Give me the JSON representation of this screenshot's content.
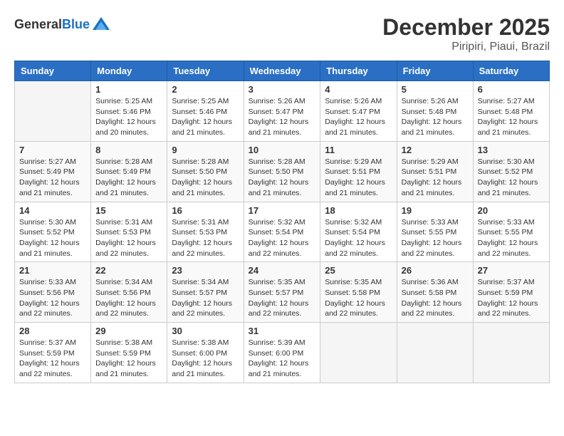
{
  "header": {
    "logo_general": "General",
    "logo_blue": "Blue",
    "month": "December 2025",
    "location": "Piripiri, Piaui, Brazil"
  },
  "weekdays": [
    "Sunday",
    "Monday",
    "Tuesday",
    "Wednesday",
    "Thursday",
    "Friday",
    "Saturday"
  ],
  "weeks": [
    [
      {
        "day": "",
        "info": ""
      },
      {
        "day": "1",
        "info": "Sunrise: 5:25 AM\nSunset: 5:46 PM\nDaylight: 12 hours\nand 20 minutes."
      },
      {
        "day": "2",
        "info": "Sunrise: 5:25 AM\nSunset: 5:46 PM\nDaylight: 12 hours\nand 21 minutes."
      },
      {
        "day": "3",
        "info": "Sunrise: 5:26 AM\nSunset: 5:47 PM\nDaylight: 12 hours\nand 21 minutes."
      },
      {
        "day": "4",
        "info": "Sunrise: 5:26 AM\nSunset: 5:47 PM\nDaylight: 12 hours\nand 21 minutes."
      },
      {
        "day": "5",
        "info": "Sunrise: 5:26 AM\nSunset: 5:48 PM\nDaylight: 12 hours\nand 21 minutes."
      },
      {
        "day": "6",
        "info": "Sunrise: 5:27 AM\nSunset: 5:48 PM\nDaylight: 12 hours\nand 21 minutes."
      }
    ],
    [
      {
        "day": "7",
        "info": "Sunrise: 5:27 AM\nSunset: 5:49 PM\nDaylight: 12 hours\nand 21 minutes."
      },
      {
        "day": "8",
        "info": "Sunrise: 5:28 AM\nSunset: 5:49 PM\nDaylight: 12 hours\nand 21 minutes."
      },
      {
        "day": "9",
        "info": "Sunrise: 5:28 AM\nSunset: 5:50 PM\nDaylight: 12 hours\nand 21 minutes."
      },
      {
        "day": "10",
        "info": "Sunrise: 5:28 AM\nSunset: 5:50 PM\nDaylight: 12 hours\nand 21 minutes."
      },
      {
        "day": "11",
        "info": "Sunrise: 5:29 AM\nSunset: 5:51 PM\nDaylight: 12 hours\nand 21 minutes."
      },
      {
        "day": "12",
        "info": "Sunrise: 5:29 AM\nSunset: 5:51 PM\nDaylight: 12 hours\nand 21 minutes."
      },
      {
        "day": "13",
        "info": "Sunrise: 5:30 AM\nSunset: 5:52 PM\nDaylight: 12 hours\nand 21 minutes."
      }
    ],
    [
      {
        "day": "14",
        "info": "Sunrise: 5:30 AM\nSunset: 5:52 PM\nDaylight: 12 hours\nand 21 minutes."
      },
      {
        "day": "15",
        "info": "Sunrise: 5:31 AM\nSunset: 5:53 PM\nDaylight: 12 hours\nand 22 minutes."
      },
      {
        "day": "16",
        "info": "Sunrise: 5:31 AM\nSunset: 5:53 PM\nDaylight: 12 hours\nand 22 minutes."
      },
      {
        "day": "17",
        "info": "Sunrise: 5:32 AM\nSunset: 5:54 PM\nDaylight: 12 hours\nand 22 minutes."
      },
      {
        "day": "18",
        "info": "Sunrise: 5:32 AM\nSunset: 5:54 PM\nDaylight: 12 hours\nand 22 minutes."
      },
      {
        "day": "19",
        "info": "Sunrise: 5:33 AM\nSunset: 5:55 PM\nDaylight: 12 hours\nand 22 minutes."
      },
      {
        "day": "20",
        "info": "Sunrise: 5:33 AM\nSunset: 5:55 PM\nDaylight: 12 hours\nand 22 minutes."
      }
    ],
    [
      {
        "day": "21",
        "info": "Sunrise: 5:33 AM\nSunset: 5:56 PM\nDaylight: 12 hours\nand 22 minutes."
      },
      {
        "day": "22",
        "info": "Sunrise: 5:34 AM\nSunset: 5:56 PM\nDaylight: 12 hours\nand 22 minutes."
      },
      {
        "day": "23",
        "info": "Sunrise: 5:34 AM\nSunset: 5:57 PM\nDaylight: 12 hours\nand 22 minutes."
      },
      {
        "day": "24",
        "info": "Sunrise: 5:35 AM\nSunset: 5:57 PM\nDaylight: 12 hours\nand 22 minutes."
      },
      {
        "day": "25",
        "info": "Sunrise: 5:35 AM\nSunset: 5:58 PM\nDaylight: 12 hours\nand 22 minutes."
      },
      {
        "day": "26",
        "info": "Sunrise: 5:36 AM\nSunset: 5:58 PM\nDaylight: 12 hours\nand 22 minutes."
      },
      {
        "day": "27",
        "info": "Sunrise: 5:37 AM\nSunset: 5:59 PM\nDaylight: 12 hours\nand 22 minutes."
      }
    ],
    [
      {
        "day": "28",
        "info": "Sunrise: 5:37 AM\nSunset: 5:59 PM\nDaylight: 12 hours\nand 22 minutes."
      },
      {
        "day": "29",
        "info": "Sunrise: 5:38 AM\nSunset: 5:59 PM\nDaylight: 12 hours\nand 21 minutes."
      },
      {
        "day": "30",
        "info": "Sunrise: 5:38 AM\nSunset: 6:00 PM\nDaylight: 12 hours\nand 21 minutes."
      },
      {
        "day": "31",
        "info": "Sunrise: 5:39 AM\nSunset: 6:00 PM\nDaylight: 12 hours\nand 21 minutes."
      },
      {
        "day": "",
        "info": ""
      },
      {
        "day": "",
        "info": ""
      },
      {
        "day": "",
        "info": ""
      }
    ]
  ]
}
